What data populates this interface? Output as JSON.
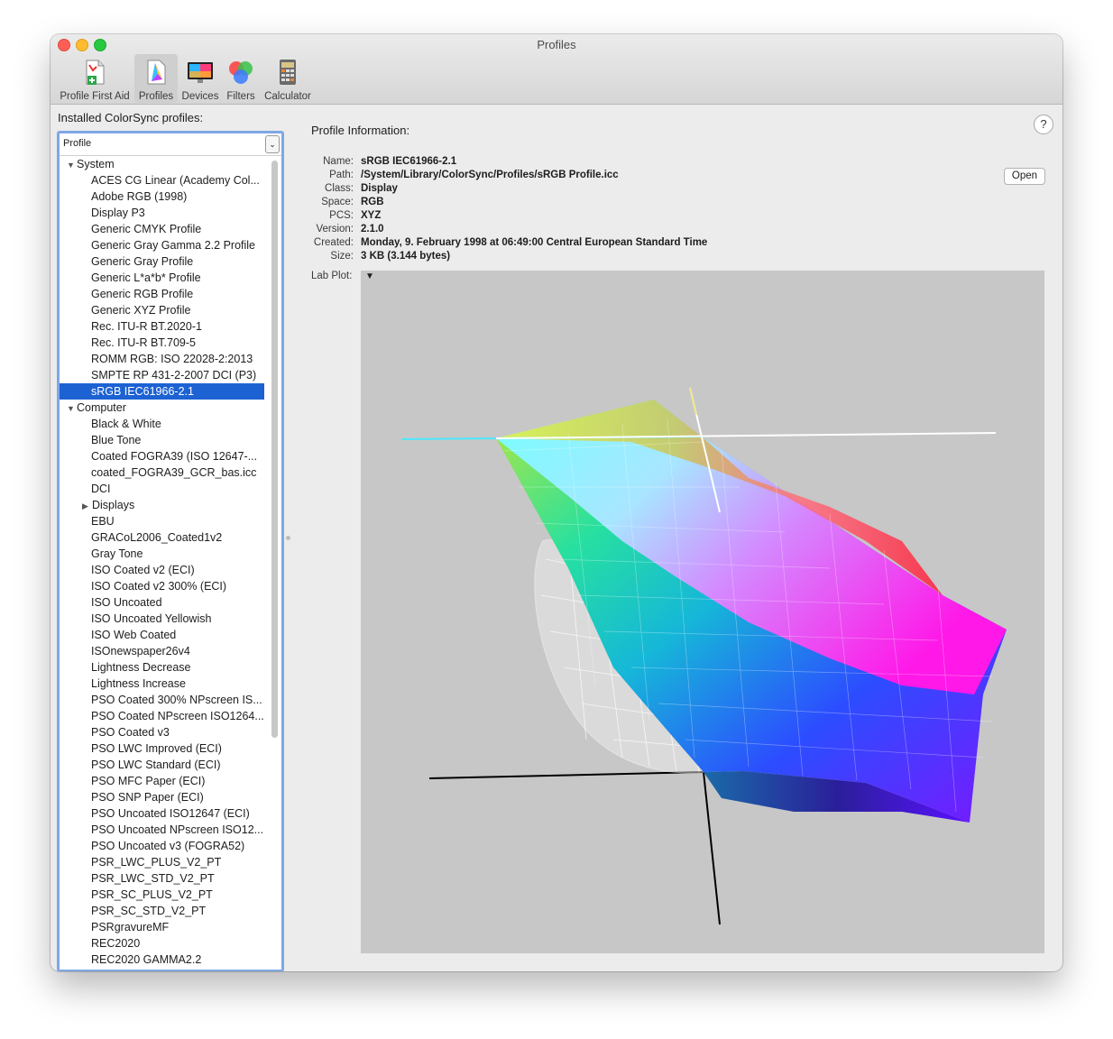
{
  "window": {
    "title": "Profiles"
  },
  "toolbar": {
    "items": [
      {
        "label": "Profile First Aid"
      },
      {
        "label": "Profiles"
      },
      {
        "label": "Devices"
      },
      {
        "label": "Filters"
      },
      {
        "label": "Calculator"
      }
    ]
  },
  "sidebar": {
    "title": "Installed ColorSync profiles:",
    "column_header": "Profile",
    "groups": [
      {
        "name": "System",
        "items": [
          "ACES CG Linear (Academy Col...",
          "Adobe RGB (1998)",
          "Display P3",
          "Generic CMYK Profile",
          "Generic Gray Gamma 2.2 Profile",
          "Generic Gray Profile",
          "Generic L*a*b* Profile",
          "Generic RGB Profile",
          "Generic XYZ Profile",
          "Rec. ITU-R BT.2020-1",
          "Rec. ITU-R BT.709-5",
          "ROMM RGB: ISO 22028-2:2013",
          "SMPTE RP 431-2-2007 DCI (P3)",
          "sRGB IEC61966-2.1"
        ]
      },
      {
        "name": "Computer",
        "items": [
          "Black & White",
          "Blue Tone",
          "Coated FOGRA39 (ISO 12647-...",
          "coated_FOGRA39_GCR_bas.icc",
          "DCI",
          "Displays",
          "EBU",
          "GRACoL2006_Coated1v2",
          "Gray Tone",
          "ISO Coated v2 (ECI)",
          "ISO Coated v2 300% (ECI)",
          "ISO Uncoated",
          "ISO Uncoated Yellowish",
          "ISO Web Coated",
          "ISOnewspaper26v4",
          "Lightness Decrease",
          "Lightness Increase",
          "PSO Coated 300% NPscreen IS...",
          "PSO Coated NPscreen ISO1264...",
          "PSO Coated v3",
          "PSO LWC Improved (ECI)",
          "PSO LWC Standard (ECI)",
          "PSO MFC Paper (ECI)",
          "PSO SNP Paper (ECI)",
          "PSO Uncoated ISO12647 (ECI)",
          "PSO Uncoated NPscreen ISO12...",
          "PSO Uncoated v3 (FOGRA52)",
          "PSR_LWC_PLUS_V2_PT",
          "PSR_LWC_STD_V2_PT",
          "PSR_SC_PLUS_V2_PT",
          "PSR_SC_STD_V2_PT",
          "PSRgravureMF",
          "REC2020",
          "REC2020 GAMMA2.2"
        ]
      }
    ],
    "selected": "sRGB IEC61966-2.1",
    "collapsed_folder": "Displays"
  },
  "info": {
    "title": "Profile Information:",
    "help": "?",
    "open_button": "Open",
    "fields": [
      {
        "label": "Name:",
        "value": "sRGB IEC61966-2.1"
      },
      {
        "label": "Path:",
        "value": "/System/Library/ColorSync/Profiles/sRGB Profile.icc"
      },
      {
        "label": "Class:",
        "value": "Display"
      },
      {
        "label": "Space:",
        "value": "RGB"
      },
      {
        "label": "PCS:",
        "value": "XYZ"
      },
      {
        "label": "Version:",
        "value": "2.1.0"
      },
      {
        "label": "Created:",
        "value": "Monday, 9. February 1998 at 06:49:00 Central European Standard Time"
      },
      {
        "label": "Size:",
        "value": "3 KB (3.144 bytes)"
      }
    ],
    "plot_label": "Lab Plot:"
  },
  "colors": {
    "selection": "#1d62d3",
    "focus_ring": "#7fa7e6",
    "plot_bg": "#c7c7c7"
  }
}
